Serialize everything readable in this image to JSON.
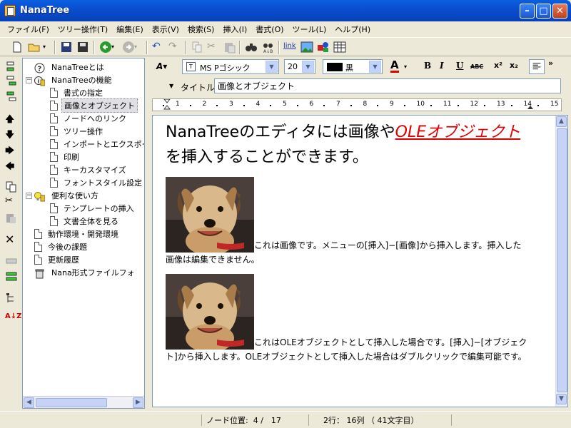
{
  "window": {
    "title": "NanaTree"
  },
  "menu": [
    "ファイル(F)",
    "ツリー操作(T)",
    "編集(E)",
    "表示(V)",
    "検索(S)",
    "挿入(I)",
    "書式(O)",
    "ツール(L)",
    "ヘルプ(H)"
  ],
  "toolbar": {
    "link_label": "link"
  },
  "tree": {
    "nodes": [
      {
        "label": "NanaTreeとは",
        "icon": "question-icon",
        "level": 1
      },
      {
        "label": "NanaTreeの機能",
        "icon": "info-book-icon",
        "level": 1,
        "expanded": true
      },
      {
        "label": "書式の指定",
        "icon": "document-icon",
        "level": 2
      },
      {
        "label": "画像とオブジェクト",
        "icon": "document-icon",
        "level": 2,
        "selected": true
      },
      {
        "label": "ノードへのリンク",
        "icon": "document-icon",
        "level": 2
      },
      {
        "label": "ツリー操作",
        "icon": "document-icon",
        "level": 2
      },
      {
        "label": "インポートとエクスポー",
        "icon": "document-icon",
        "level": 2
      },
      {
        "label": "印刷",
        "icon": "document-icon",
        "level": 2
      },
      {
        "label": "キーカスタマイズ",
        "icon": "document-icon",
        "level": 2
      },
      {
        "label": "フォントスタイル設定",
        "icon": "document-icon",
        "level": 2
      },
      {
        "label": "便利な使い方",
        "icon": "bulb-book-icon",
        "level": 1,
        "expanded": true
      },
      {
        "label": "テンプレートの挿入",
        "icon": "document-icon",
        "level": 2
      },
      {
        "label": "文書全体を見る",
        "icon": "document-icon",
        "level": 2
      },
      {
        "label": "動作環境・開発環境",
        "icon": "document-icon",
        "level": 1
      },
      {
        "label": "今後の課題",
        "icon": "document-icon",
        "level": 1
      },
      {
        "label": "更新履歴",
        "icon": "document-icon",
        "level": 1
      },
      {
        "label": "Nana形式ファイルフォ",
        "icon": "trash-icon",
        "level": 1
      }
    ]
  },
  "format": {
    "font": "MS Pゴシック",
    "size": "20",
    "color_name": "黒",
    "color_hex": "#000000",
    "bold": "B",
    "italic": "I",
    "underline": "U",
    "strike": "ABC",
    "superscript": "x²",
    "subscript": "x₂",
    "title_caption": "タイトル",
    "title_value": "画像とオブジェクト"
  },
  "ruler": {
    "marks": [
      "1",
      "2",
      "3",
      "4",
      "5",
      "6",
      "7",
      "8",
      "9",
      "10",
      "11",
      "12",
      "13",
      "14",
      "15"
    ]
  },
  "document": {
    "heading_before": "NanaTreeのエディタには画像や",
    "heading_link": "OLEオブジェクト",
    "heading_after": "を挿入することができます。",
    "para1": "これは画像です。メニューの[挿入]−[画像]から挿入します。挿入した画像は編集できません。",
    "para2": "これはOLEオブジェクトとして挿入した場合です。[挿入]−[オブジェクト]から挿入します。OLEオブジェクトとして挿入した場合はダブルクリックで編集可能です。"
  },
  "status": {
    "node_position_label": "ノード位置:",
    "node_position_value": "4 /　17",
    "line_col": "2行： 16列 （ 41文字目）"
  }
}
